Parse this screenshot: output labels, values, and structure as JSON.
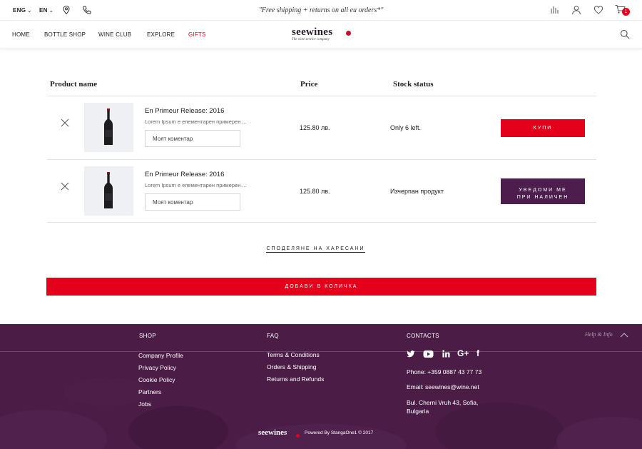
{
  "header": {
    "lang_primary": "ENG",
    "lang_secondary": "EN",
    "promo": "\"Free shipping + returns on all eu orders*\"",
    "cart_count": "1",
    "icons": [
      "location-pin-icon",
      "phone-icon",
      "compare-icon",
      "user-icon",
      "heart-icon",
      "cart-icon",
      "search-icon"
    ]
  },
  "nav": {
    "items": [
      {
        "label": "HOME"
      },
      {
        "label": "BOTTLE SHOP"
      },
      {
        "label": "WINE CLUB"
      },
      {
        "label": "EXPLORE"
      },
      {
        "label": "GIFTS"
      }
    ],
    "logo_text": "seewines",
    "logo_tagline": "The wine service company"
  },
  "table": {
    "headers": {
      "product": "Product name",
      "price": "Price",
      "stock": "Stock status"
    },
    "rows": [
      {
        "name": "En Primeur Release: 2016",
        "desc": "Lorem Ipsum е елементарен примерен ...",
        "comment_placeholder": "Моят коментар",
        "price": "125.80 лв.",
        "stock": "Only 6 left.",
        "action": "КУПИ"
      },
      {
        "name": "En Primeur Release: 2016",
        "desc": "Lorem Ipsum е елементарен примерен ...",
        "comment_placeholder": "Моят коментар",
        "price": "125.80 лв.",
        "stock": "Изчерпан продукт",
        "action_line1": "УВЕДОМИ МЕ",
        "action_line2": "ПРИ НАЛИЧЕН"
      }
    ]
  },
  "share_label": "СПОДЕЛЯНЕ НА ХАРЕСАНИ",
  "add_to_cart_label": "ДОБАВИ В КОЛИЧКА",
  "footer": {
    "shop": {
      "heading": "SHOP",
      "links": [
        "Company Profile",
        "Privacy Policy",
        "Cookie Policy",
        "Partners",
        "Jobs"
      ]
    },
    "faq": {
      "heading": "FAQ",
      "links": [
        "Terms & Conditions",
        "Orders & Shipping",
        "Returns and Refunds"
      ]
    },
    "contacts": {
      "heading": "CONTACTS",
      "phone": "Phone: +359 0887 43 77  73",
      "email": "Email: seewines@wine.net",
      "address_line1": "Bul. Cherni Vruh 43, Sofia,",
      "address_line2": "Bulgaria"
    },
    "social": [
      "twitter-icon",
      "youtube-icon",
      "linkedin-icon",
      "google-plus-icon",
      "facebook-icon"
    ],
    "help": "Help & Info",
    "logo_text": "seewines",
    "powered": "Powered By StangaOne1 © 2017"
  },
  "colors": {
    "accent_red": "#e4001b",
    "plum": "#4d1e4d",
    "footer_bg": "#4a1c46"
  }
}
